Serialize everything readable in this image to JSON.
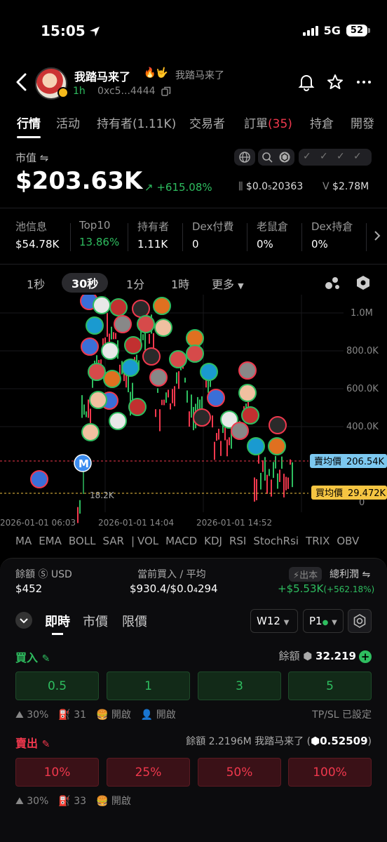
{
  "status": {
    "time": "15:05",
    "network": "5G",
    "battery": "52"
  },
  "token": {
    "name": "我踏马来了",
    "emojis": "🔥🤟",
    "sub_name": "我踏马来了",
    "age": "1h",
    "address": "0xc5...4444"
  },
  "tabs": [
    {
      "label": "行情",
      "active": true
    },
    {
      "label": "活动"
    },
    {
      "label": "持有者(1.11K)"
    },
    {
      "label": "交易者"
    },
    {
      "label": "訂單",
      "badge": "(35)"
    },
    {
      "label": "持倉"
    },
    {
      "label": "開發"
    }
  ],
  "market": {
    "label": "市值 ⇋",
    "value": "$203.63K",
    "change": "+615.08%",
    "price": "$0.0₅20363",
    "volume_prefix": "V",
    "volume": "$2.78M"
  },
  "stats": [
    {
      "label": "池信息",
      "value": "$54.78K"
    },
    {
      "label": "Top10",
      "value": "13.86%",
      "green": true
    },
    {
      "label": "持有者",
      "value": "1.11K"
    },
    {
      "label": "Dex付費",
      "value": "0"
    },
    {
      "label": "老鼠倉",
      "value": "0%"
    },
    {
      "label": "Dex持倉",
      "value": "0%"
    }
  ],
  "intervals": [
    "1秒",
    "30秒",
    "1分",
    "1時",
    "更多"
  ],
  "chart": {
    "y_ticks": [
      "1.0M",
      "800.0K",
      "600.0K",
      "400.0K",
      "0"
    ],
    "x_ticks": [
      "2026-01-01 06:03",
      "2026-01-01 14:04",
      "2026-01-01 14:52"
    ],
    "sell_avg_label": "賣均價",
    "sell_avg_value": "206.54K",
    "buy_avg_label": "買均價",
    "buy_avg_value": "29.472K",
    "low_label": "18.2K",
    "marker": "M",
    "colors": {
      "up": "#2ebd5f",
      "down": "#f0384d",
      "sell_tag": "#7cc8f0",
      "buy_tag": "#f5c542"
    }
  },
  "indicators": [
    "MA",
    "EMA",
    "BOLL",
    "SAR",
    "|",
    "VOL",
    "MACD",
    "KDJ",
    "RSI",
    "StochRsi",
    "TRIX",
    "OBV"
  ],
  "panel": {
    "balance_label": "餘額 Ⓢ USD",
    "balance_value": "$452",
    "current_label": "當前買入 / 平均",
    "current_value": "$930.4/$0.0₄294",
    "profit_tag": "⚡出本",
    "profit_label": "總利潤 ⇋",
    "profit_value": "+$5.53K",
    "profit_pct": "(+562.18%)",
    "modes": [
      "即時",
      "市價",
      "限價"
    ],
    "selector_w": "W12",
    "selector_p": "P1",
    "buy_label": "買入",
    "buy_balance_label": "餘額",
    "buy_balance_value": "32.219",
    "buy_amounts": [
      "0.5",
      "1",
      "3",
      "5"
    ],
    "buy_options": [
      "⛰ 30%",
      "⛽ 31",
      "🍔 開啟",
      "👤 開啟"
    ],
    "tpsl": "TP/SL 已設定",
    "sell_label": "賣出",
    "sell_balance_label": "餘額 2.2196M 我踏马来了 (",
    "sell_balance_value": "0.52509",
    "sell_balance_suffix": ")",
    "sell_amounts": [
      "10%",
      "25%",
      "50%",
      "100%"
    ],
    "sell_options": [
      "⛰ 30%",
      "⛽ 33",
      "🍔 開啟"
    ]
  }
}
